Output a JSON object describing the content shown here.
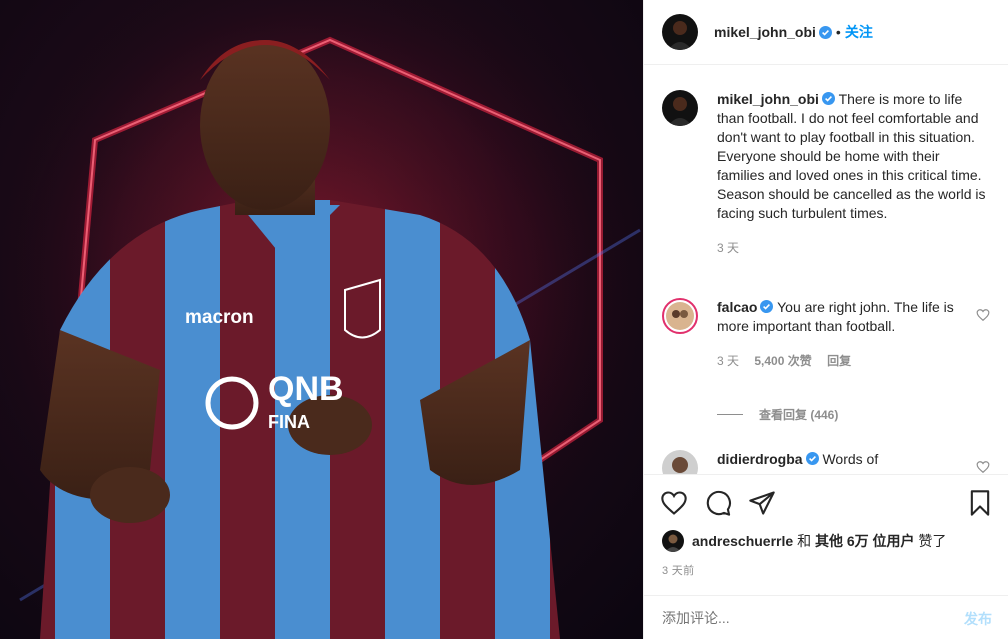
{
  "post": {
    "username": "mikel_john_obi",
    "dot": "•",
    "follow_label": "关注",
    "image_icon": "jersey-photo"
  },
  "caption": {
    "username": "mikel_john_obi",
    "text": "There is more to life than football. I do not feel comfortable and don't want to play football in this situation. Everyone should be home with their families and loved ones in this critical time. Season should be cancelled as the world is facing such turbulent times.",
    "time": "3 天"
  },
  "comments": [
    {
      "username": "falcao",
      "text": "You are right john. The life is more important than football.",
      "time": "3 天",
      "likes": "5,400 次赞",
      "reply_label": "回复",
      "view_replies": "查看回复 (446)"
    },
    {
      "username": "didierdrogba",
      "text": "Words of"
    }
  ],
  "likes": {
    "username": "andreschuerrle",
    "connector": "和",
    "others": "其他 6万 位用户",
    "suffix": "赞了"
  },
  "post_time": "3 天前",
  "add_comment": {
    "placeholder": "添加评论...",
    "post_label": "发布"
  },
  "colors": {
    "accent": "#0095f6",
    "verified": "#3897f0",
    "post_disabled": "#b2dffc"
  }
}
